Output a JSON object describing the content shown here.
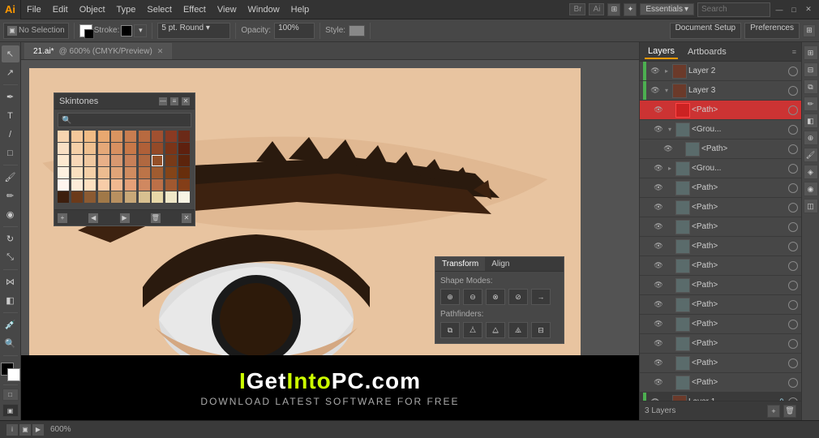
{
  "app": {
    "logo": "Ai",
    "title": "Adobe Illustrator"
  },
  "menubar": {
    "items": [
      "File",
      "Edit",
      "Object",
      "Type",
      "Select",
      "Effect",
      "View",
      "Window",
      "Help"
    ],
    "br_icon": "Br",
    "ai_icon": "Ai",
    "workspace_label": "Essentials",
    "search_placeholder": "Search"
  },
  "toolbar": {
    "selection_label": "No Selection",
    "stroke_label": "Stroke:",
    "brush_label": "5 pt. Round",
    "opacity_label": "Opacity:",
    "opacity_value": "100%",
    "style_label": "Style:",
    "doc_setup_label": "Document Setup",
    "prefs_label": "Preferences"
  },
  "canvas_tab": {
    "name": "21.ai*",
    "zoom": "600%",
    "mode": "CMYK/Preview"
  },
  "skintones_panel": {
    "title": "Skintones",
    "search_placeholder": "🔍",
    "colors": [
      "#f8d5b0",
      "#f5c89a",
      "#f0bb85",
      "#e8a870",
      "#d99460",
      "#c87d50",
      "#b86a40",
      "#a05030",
      "#8a3a22",
      "#6b2a18",
      "#f9dfc4",
      "#f5d0a8",
      "#efc090",
      "#e5a878",
      "#d89060",
      "#c87848",
      "#b06038",
      "#944a28",
      "#7a3418",
      "#5e200e",
      "#fce8d0",
      "#f8d8b8",
      "#f0c8a0",
      "#e8b088",
      "#d89870",
      "#c88058",
      "#b06840",
      "#945028",
      "#783a18",
      "#5c240c",
      "#fdf0e0",
      "#fae0c0",
      "#f5d0a8",
      "#ecbc90",
      "#e0a478",
      "#d08c60",
      "#bc7448",
      "#a05c30",
      "#844418",
      "#682e0c",
      "#fff5ee",
      "#feecd8",
      "#fde0c0",
      "#f8cca8",
      "#f0b890",
      "#e4a078",
      "#d08860",
      "#bc7048",
      "#a05830",
      "#843e18",
      "#3d1f0e",
      "#6b3a1a",
      "#8b5a32",
      "#a07848",
      "#b89060",
      "#c8a878",
      "#d8c090",
      "#e8d8a8",
      "#f0e8c8",
      "#f8f4e4"
    ]
  },
  "transform_panel": {
    "tabs": [
      "Transform",
      "Align"
    ],
    "active_tab": "Transform",
    "shape_modes_label": "Shape Modes:",
    "shape_buttons": [
      "⊕",
      "⊖",
      "⊗",
      "⊘"
    ],
    "pathfinders_label": "Pathfinders:",
    "pathfinder_buttons": [
      "⧉",
      "⧊",
      "⧋",
      "⧌"
    ]
  },
  "layers_panel": {
    "tabs": [
      "Layers",
      "Artboards"
    ],
    "active_tab": "Layers",
    "items": [
      {
        "name": "Layer 2",
        "level": 0,
        "expanded": false,
        "visible": true,
        "locked": false,
        "type": "layer"
      },
      {
        "name": "Layer 3",
        "level": 0,
        "expanded": true,
        "visible": true,
        "locked": false,
        "type": "layer"
      },
      {
        "name": "<Path>",
        "level": 1,
        "expanded": false,
        "visible": true,
        "locked": false,
        "type": "path",
        "selected": true,
        "highlighted": true
      },
      {
        "name": "<Grou...",
        "level": 1,
        "expanded": true,
        "visible": true,
        "locked": false,
        "type": "group"
      },
      {
        "name": "<Path>",
        "level": 2,
        "expanded": false,
        "visible": true,
        "locked": false,
        "type": "path"
      },
      {
        "name": "<Grou...",
        "level": 1,
        "expanded": false,
        "visible": true,
        "locked": false,
        "type": "group"
      },
      {
        "name": "<Path>",
        "level": 1,
        "expanded": false,
        "visible": true,
        "locked": false,
        "type": "path"
      },
      {
        "name": "<Path>",
        "level": 1,
        "expanded": false,
        "visible": true,
        "locked": false,
        "type": "path"
      },
      {
        "name": "<Path>",
        "level": 1,
        "expanded": false,
        "visible": true,
        "locked": false,
        "type": "path"
      },
      {
        "name": "<Path>",
        "level": 1,
        "expanded": false,
        "visible": true,
        "locked": false,
        "type": "path"
      },
      {
        "name": "<Path>",
        "level": 1,
        "expanded": false,
        "visible": true,
        "locked": false,
        "type": "path"
      },
      {
        "name": "<Path>",
        "level": 1,
        "expanded": false,
        "visible": true,
        "locked": false,
        "type": "path"
      },
      {
        "name": "<Path>",
        "level": 1,
        "expanded": false,
        "visible": true,
        "locked": false,
        "type": "path"
      },
      {
        "name": "<Path>",
        "level": 1,
        "expanded": false,
        "visible": true,
        "locked": false,
        "type": "path"
      },
      {
        "name": "<Path>",
        "level": 1,
        "expanded": false,
        "visible": true,
        "locked": false,
        "type": "path"
      },
      {
        "name": "<Path>",
        "level": 1,
        "expanded": false,
        "visible": true,
        "locked": false,
        "type": "path"
      },
      {
        "name": "<Path>",
        "level": 1,
        "expanded": false,
        "visible": true,
        "locked": false,
        "type": "path"
      },
      {
        "name": "Layer 1",
        "level": 0,
        "expanded": false,
        "visible": true,
        "locked": true,
        "type": "layer"
      }
    ],
    "footer_label": "3 Layers"
  },
  "status_bar": {
    "zoom": "600%",
    "info": ""
  },
  "watermark": {
    "text_i": "I",
    "text_get": "Get",
    "text_into": "Into",
    "text_pc": "PC",
    "text_com": ".com",
    "subtitle": "Download Latest Software for Free"
  }
}
